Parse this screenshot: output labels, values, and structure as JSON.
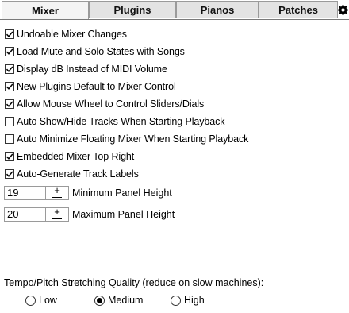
{
  "tabs": [
    {
      "label": "Mixer",
      "active": true
    },
    {
      "label": "Plugins",
      "active": false
    },
    {
      "label": "Pianos",
      "active": false
    },
    {
      "label": "Patches",
      "active": false
    }
  ],
  "settings_icon": "gear-icon",
  "options": [
    {
      "label": "Undoable Mixer Changes",
      "checked": true
    },
    {
      "label": "Load Mute and Solo States with Songs",
      "checked": true
    },
    {
      "label": "Display dB Instead of MIDI Volume",
      "checked": true
    },
    {
      "label": "New Plugins Default to Mixer Control",
      "checked": true
    },
    {
      "label": "Allow Mouse Wheel to Control Sliders/Dials",
      "checked": true
    },
    {
      "label": "Auto Show/Hide Tracks When Starting Playback",
      "checked": false
    },
    {
      "label": "Auto Minimize Floating Mixer When Starting Playback",
      "checked": false
    },
    {
      "label": "Embedded Mixer Top Right",
      "checked": true
    },
    {
      "label": "Auto-Generate Track Labels",
      "checked": true
    }
  ],
  "spinners": [
    {
      "value": "19",
      "plus": "+",
      "label": "Minimum Panel Height"
    },
    {
      "value": "20",
      "plus": "+",
      "label": "Maximum Panel Height"
    }
  ],
  "tempo": {
    "label": "Tempo/Pitch Stretching Quality (reduce on slow machines):",
    "choices": [
      {
        "label": "Low",
        "selected": false
      },
      {
        "label": "Medium",
        "selected": true
      },
      {
        "label": "High",
        "selected": false
      }
    ]
  }
}
